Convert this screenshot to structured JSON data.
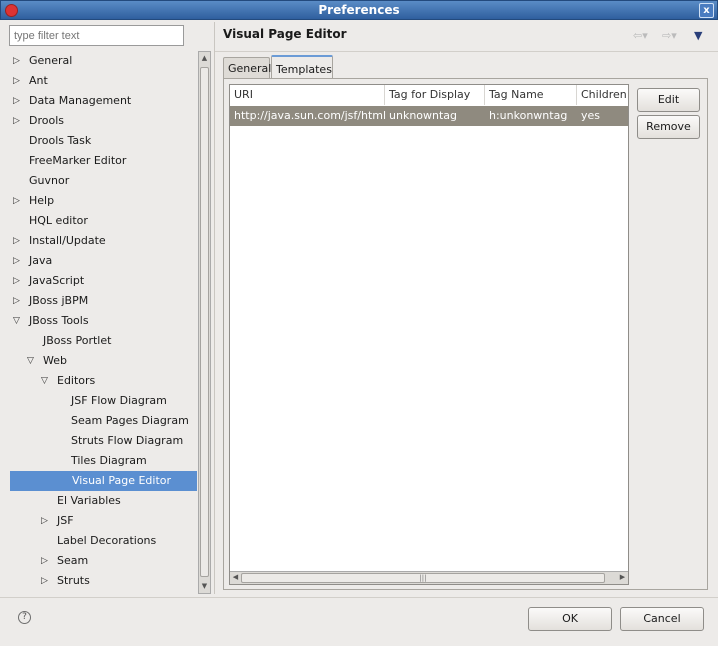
{
  "window": {
    "title": "Preferences"
  },
  "filter": {
    "placeholder": "type filter text"
  },
  "tree": [
    {
      "label": "General",
      "level": 0,
      "arrow": "right"
    },
    {
      "label": "Ant",
      "level": 0,
      "arrow": "right"
    },
    {
      "label": "Data Management",
      "level": 0,
      "arrow": "right"
    },
    {
      "label": "Drools",
      "level": 0,
      "arrow": "right"
    },
    {
      "label": "Drools Task",
      "level": 0,
      "arrow": ""
    },
    {
      "label": "FreeMarker Editor",
      "level": 0,
      "arrow": ""
    },
    {
      "label": "Guvnor",
      "level": 0,
      "arrow": ""
    },
    {
      "label": "Help",
      "level": 0,
      "arrow": "right"
    },
    {
      "label": "HQL editor",
      "level": 0,
      "arrow": ""
    },
    {
      "label": "Install/Update",
      "level": 0,
      "arrow": "right"
    },
    {
      "label": "Java",
      "level": 0,
      "arrow": "right"
    },
    {
      "label": "JavaScript",
      "level": 0,
      "arrow": "right"
    },
    {
      "label": "JBoss jBPM",
      "level": 0,
      "arrow": "right"
    },
    {
      "label": "JBoss Tools",
      "level": 0,
      "arrow": "down"
    },
    {
      "label": "JBoss Portlet",
      "level": 1,
      "arrow": ""
    },
    {
      "label": "Web",
      "level": 1,
      "arrow": "down"
    },
    {
      "label": "Editors",
      "level": 2,
      "arrow": "down"
    },
    {
      "label": "JSF Flow Diagram",
      "level": 3,
      "arrow": ""
    },
    {
      "label": "Seam Pages Diagram",
      "level": 3,
      "arrow": ""
    },
    {
      "label": "Struts Flow Diagram",
      "level": 3,
      "arrow": ""
    },
    {
      "label": "Tiles Diagram",
      "level": 3,
      "arrow": ""
    },
    {
      "label": "Visual Page Editor",
      "level": 3,
      "arrow": "",
      "selected": true
    },
    {
      "label": "El Variables",
      "level": 2,
      "arrow": ""
    },
    {
      "label": "JSF",
      "level": 2,
      "arrow": "right"
    },
    {
      "label": "Label Decorations",
      "level": 2,
      "arrow": ""
    },
    {
      "label": "Seam",
      "level": 2,
      "arrow": "right"
    },
    {
      "label": "Struts",
      "level": 2,
      "arrow": "right"
    }
  ],
  "page": {
    "title": "Visual Page Editor"
  },
  "tabs": [
    {
      "label": "General"
    },
    {
      "label": "Templates",
      "active": true
    }
  ],
  "table": {
    "columns": [
      "URI",
      "Tag for Display",
      "Tag Name",
      "Children"
    ],
    "rows": [
      [
        "http://java.sun.com/jsf/html",
        "unknowntag",
        "h:unkonwntag",
        "yes"
      ]
    ]
  },
  "buttons": {
    "edit": "Edit",
    "remove": "Remove",
    "ok": "OK",
    "cancel": "Cancel"
  },
  "icons": {
    "help": "?",
    "close": "x"
  },
  "colors": {
    "titlebar": "#3a6ea5",
    "selection": "#5b8fd1",
    "row_selection": "#8f8a7f"
  }
}
